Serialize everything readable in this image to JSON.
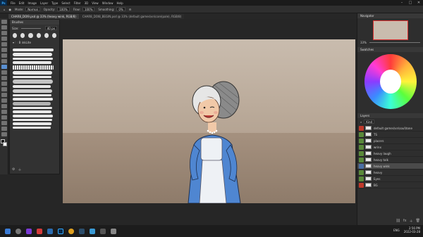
{
  "app": {
    "logo": "Ps",
    "menu": [
      "File",
      "Edit",
      "Image",
      "Layer",
      "Type",
      "Select",
      "Filter",
      "3D",
      "View",
      "Window",
      "Help"
    ]
  },
  "options_bar": {
    "mode_label": "Mode:",
    "mode_value": "Normal",
    "opacity_label": "Opacity:",
    "opacity_value": "100%",
    "flow_label": "Flow:",
    "flow_value": "100%",
    "smoothing_label": "Smoothing:",
    "smoothing_value": "0%"
  },
  "tabs": [
    {
      "label": "CHAR8_DOI9.psd @ 33% (heavy wink, RGB/8)",
      "active": true
    },
    {
      "label": "CHAR8_DOI8_BEGIN.psd @ 33% (default games\\vn\\core(pale), RGB/8)",
      "active": false
    }
  ],
  "brush_panel": {
    "title": "Brushes",
    "size_label": "Size:",
    "size_value": "40 px",
    "folder_label": "B inkLite"
  },
  "navigator": {
    "title": "Navigator",
    "zoom": "33%"
  },
  "swatches": {
    "title": "Swatches"
  },
  "layers_panel": {
    "title": "Layers",
    "kind_label": "Kind",
    "layers": [
      {
        "name": "default games\\vn\\soul\\tone",
        "visible": true,
        "selected": false
      },
      {
        "name": "TS",
        "visible": false,
        "selected": false
      },
      {
        "name": "placers",
        "visible": false,
        "selected": false
      },
      {
        "name": "wrinx",
        "visible": false,
        "selected": false
      },
      {
        "name": "heavy laugh",
        "visible": false,
        "selected": false
      },
      {
        "name": "heavy talk",
        "visible": false,
        "selected": false
      },
      {
        "name": "heavy wink",
        "visible": true,
        "selected": true
      },
      {
        "name": "heavy",
        "visible": true,
        "selected": false
      },
      {
        "name": "Eyes",
        "visible": true,
        "selected": false
      },
      {
        "name": "BG",
        "visible": true,
        "selected": false
      }
    ]
  },
  "tray": {
    "lang": "ENG",
    "time": "2:56 PM",
    "date": "2022-03-28"
  },
  "colors": {
    "accent": "#31a8ff",
    "canvas_bg_top": "#cfc2b4",
    "canvas_bg_floor": "#9c8a78",
    "dress": "#4f86d1",
    "apron": "#eef1f5",
    "hair": "#e6e6e6",
    "net": "#8a8a8a"
  }
}
